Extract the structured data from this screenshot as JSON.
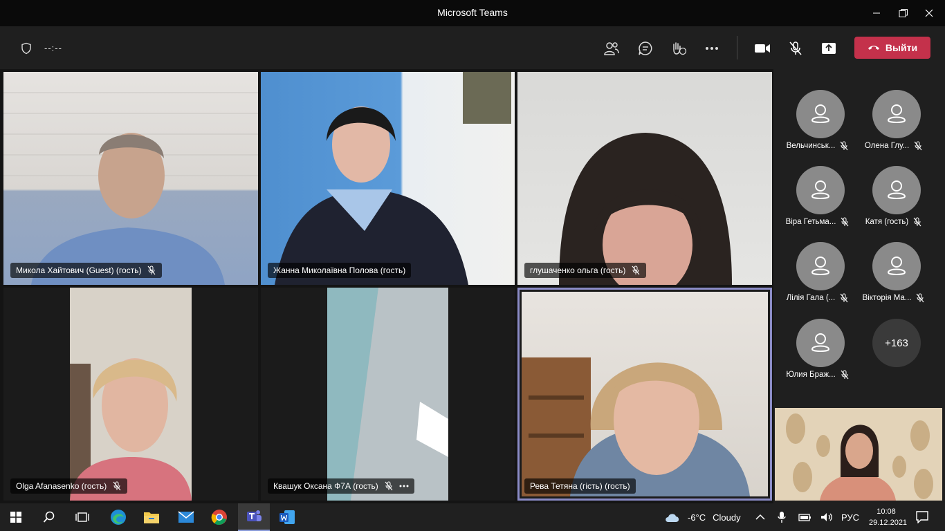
{
  "window": {
    "title": "Microsoft Teams"
  },
  "toolbar": {
    "timer": "--:--",
    "leave_label": "Выйти"
  },
  "tiles": [
    {
      "name": "Микола Хайтович (Guest) (гость)"
    },
    {
      "name": "Жанна Миколаївна Полова (гость)"
    },
    {
      "name": "глушаченко ольга (гость)"
    },
    {
      "name": "Olga Afanasenko (гость)"
    },
    {
      "name": "Квашук Оксана Ф7А (гость)"
    },
    {
      "name": "Рева Тетяна (гість) (гость)"
    }
  ],
  "sidebar": {
    "participants": [
      {
        "name": "Вельчинськ..."
      },
      {
        "name": "Олена Глу..."
      },
      {
        "name": "Віра Гетьма..."
      },
      {
        "name": "Катя (гость)"
      },
      {
        "name": "Лілія Гала (..."
      },
      {
        "name": "Вікторія Ма..."
      },
      {
        "name": "Юлия Браж..."
      }
    ],
    "more_count": "+163"
  },
  "taskbar": {
    "weather_temp": "-6°C",
    "weather_desc": "Cloudy",
    "lang": "РУС",
    "time": "10:08",
    "date": "29.12.2021"
  },
  "colors": {
    "leave": "#c4314b",
    "active_speaker": "#8b8cc7",
    "toolbar": "#1f1f1f"
  }
}
